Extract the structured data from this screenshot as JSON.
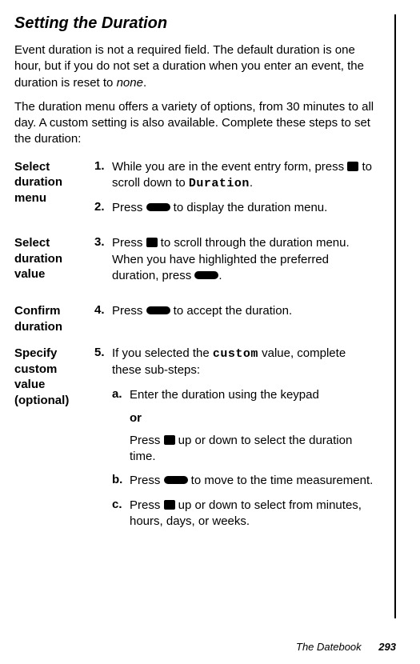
{
  "title": "Setting the Duration",
  "intro1_a": "Event duration is not a required field. The default duration is one hour, but if you do not set a duration when you enter an event, the duration is reset to ",
  "intro1_none": "none",
  "intro1_b": ".",
  "intro2": "The duration menu offers a variety of options, from 30 minutes to all day. A custom setting is also available. Complete these steps to set the duration:",
  "rows": {
    "r1_label_a": "Select",
    "r1_label_b": "duration",
    "r1_label_c": "menu",
    "r1_s1_num": "1.",
    "r1_s1_a": "While you are in the event entry form, press ",
    "r1_s1_b": " to scroll down to ",
    "r1_s1_mono": "Duration",
    "r1_s1_c": ".",
    "r1_s2_num": "2.",
    "r1_s2_a": "Press ",
    "r1_s2_b": " to display the duration menu.",
    "r2_label_a": "Select",
    "r2_label_b": "duration",
    "r2_label_c": "value",
    "r2_s3_num": "3.",
    "r2_s3_a": "Press ",
    "r2_s3_b": " to scroll through the duration menu. When you have highlighted the preferred duration, press ",
    "r2_s3_c": ".",
    "r3_label_a": "Confirm",
    "r3_label_b": "duration",
    "r3_s4_num": "4.",
    "r3_s4_a": "Press ",
    "r3_s4_b": " to accept the duration.",
    "r4_label_a": "Specify",
    "r4_label_b": "custom",
    "r4_label_c": "value",
    "r4_label_d": "(optional)",
    "r4_s5_num": "5.",
    "r4_s5_a": "If you selected the ",
    "r4_s5_mono": "custom",
    "r4_s5_b": " value, complete these sub-steps:",
    "r4_a_num": "a.",
    "r4_a_text": "Enter the duration using the keypad",
    "r4_or": "or",
    "r4_or_text_a": "Press ",
    "r4_or_text_b": " up or down to select the duration time.",
    "r4_b_num": "b.",
    "r4_b_a": "Press ",
    "r4_b_b": " to move to the time measurement.",
    "r4_c_num": "c.",
    "r4_c_a": "Press ",
    "r4_c_b": " up or down to select from minutes, hours, days, or weeks."
  },
  "footer_label": "The Datebook",
  "footer_page": "293"
}
